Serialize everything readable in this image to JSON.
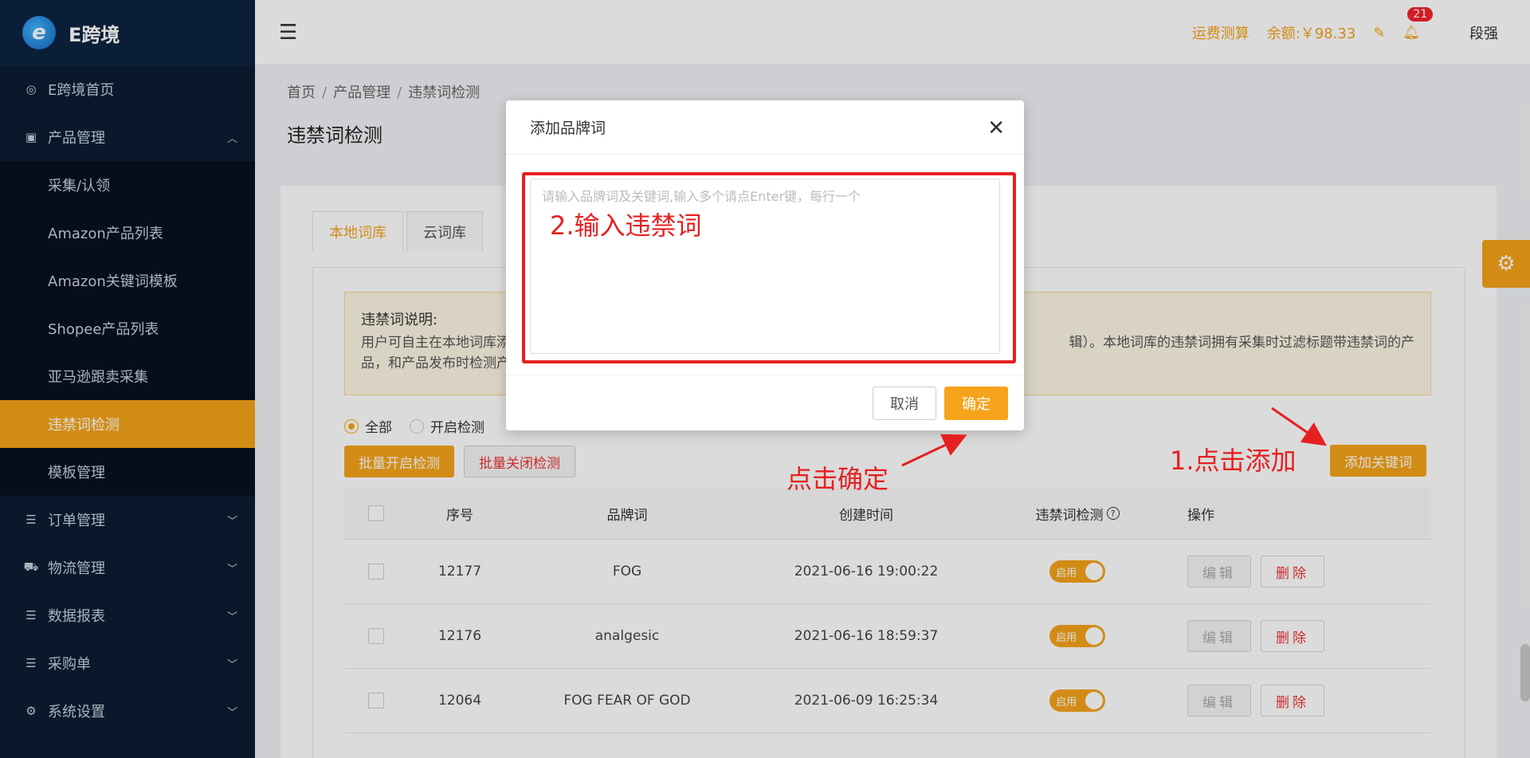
{
  "sidebar": {
    "logo": "E跨境",
    "items": [
      {
        "label": "E跨境首页",
        "icon": "home-swirl-icon"
      },
      {
        "label": "产品管理",
        "icon": "product-icon",
        "expanded": true,
        "children": [
          "采集/认领",
          "Amazon产品列表",
          "Amazon关键词模板",
          "Shopee产品列表",
          "亚马逊跟卖采集",
          "违禁词检测",
          "模板管理"
        ],
        "active_child": "违禁词检测"
      },
      {
        "label": "订单管理",
        "icon": "list-icon"
      },
      {
        "label": "物流管理",
        "icon": "truck-icon"
      },
      {
        "label": "数据报表",
        "icon": "report-icon"
      },
      {
        "label": "采购单",
        "icon": "purchase-icon"
      },
      {
        "label": "系统设置",
        "icon": "gear-icon"
      }
    ]
  },
  "header": {
    "freight": "运费测算",
    "balance": "余额:￥98.33",
    "bell_count": "21",
    "user": "段强"
  },
  "breadcrumb": [
    "首页",
    "产品管理",
    "违禁词检测"
  ],
  "page_title": "违禁词检测",
  "tabs": [
    {
      "label": "本地词库",
      "active": true
    },
    {
      "label": "云词库",
      "active": false
    }
  ],
  "notice": {
    "title": "违禁词说明:",
    "line1_left": "用户可自主在本地词库添",
    "line1_right": "辑）。本地词库的违禁词拥有采集时过滤标题带违禁词的产",
    "line2": "品，和产品发布时检测产"
  },
  "filters": {
    "all": "全部",
    "enabled": "开启检测"
  },
  "buttons": {
    "batch_on": "批量开启检测",
    "batch_off": "批量关闭检测",
    "add_keyword": "添加关键词"
  },
  "table": {
    "headers": [
      "序号",
      "品牌词",
      "创建时间",
      "违禁词检测",
      "操作"
    ],
    "rows": [
      {
        "seq": "12177",
        "brand": "FOG",
        "time": "2021-06-16 19:00:22",
        "status": "启用"
      },
      {
        "seq": "12176",
        "brand": "analgesic",
        "time": "2021-06-16 18:59:37",
        "status": "启用"
      },
      {
        "seq": "12064",
        "brand": "FOG FEAR OF GOD",
        "time": "2021-06-09 16:25:34",
        "status": "启用"
      }
    ],
    "edit_label": "编辑",
    "delete_label": "删除"
  },
  "dialog": {
    "title": "添加品牌词",
    "placeholder": "请输入品牌词及关键词,输入多个请点Enter键，每行一个",
    "cancel": "取消",
    "confirm": "确定"
  },
  "annotations": {
    "step1": "1.点击添加",
    "step2": "2.输入违禁词",
    "confirm": "点击确定"
  },
  "colors": {
    "accent": "#f5a31a",
    "sidebar_bg": "#0b1d33",
    "annotation": "#e62020"
  }
}
